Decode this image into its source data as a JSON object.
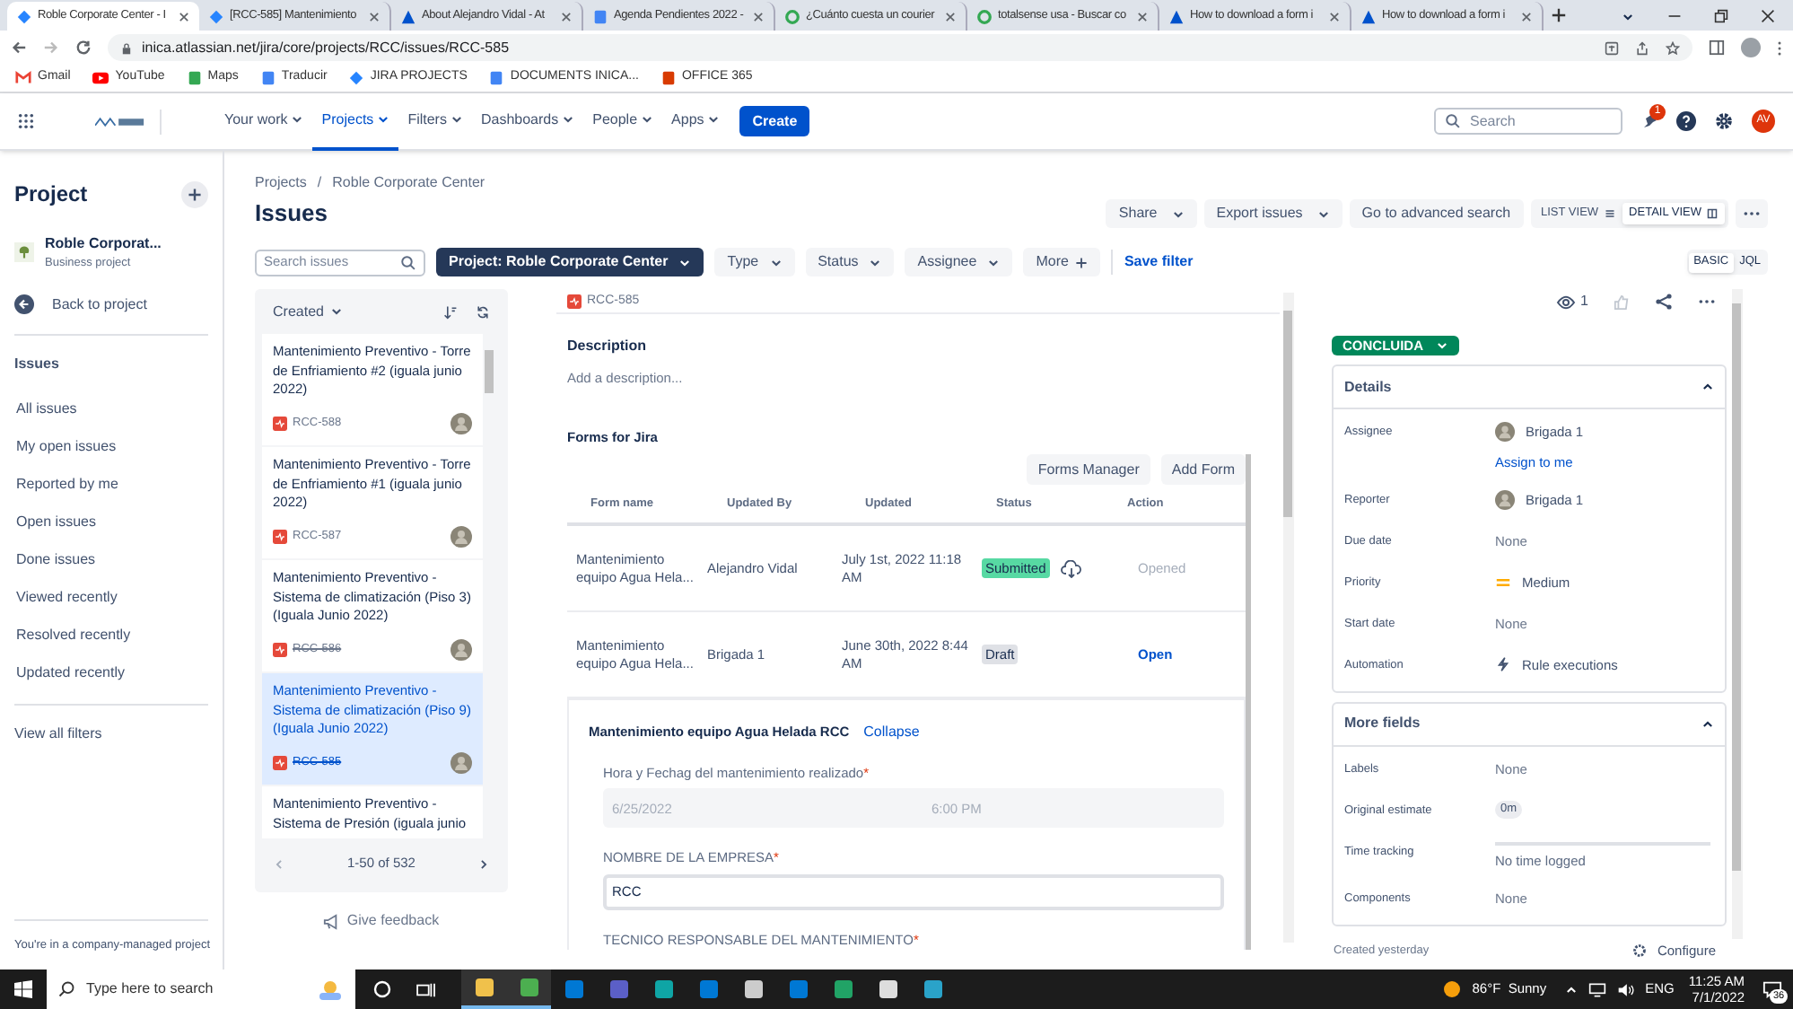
{
  "browser": {
    "tabs": [
      {
        "title": "Roble Corporate Center - I",
        "selected": true
      },
      {
        "title": "[RCC-585] Mantenimiento",
        "selected": false
      },
      {
        "title": "About Alejandro Vidal - At",
        "selected": false
      },
      {
        "title": "Agenda Pendientes 2022 -",
        "selected": false
      },
      {
        "title": "¿Cuánto cuesta un courier",
        "selected": false
      },
      {
        "title": "totalsense usa - Buscar co",
        "selected": false
      },
      {
        "title": "How to download a form i",
        "selected": false
      },
      {
        "title": "How to download a form i",
        "selected": false
      }
    ],
    "url": "inica.atlassian.net/jira/core/projects/RCC/issues/RCC-585",
    "bookmarks": [
      "Gmail",
      "YouTube",
      "Maps",
      "Traducir",
      "JIRA PROJECTS",
      "DOCUMENTS INICA...",
      "OFFICE 365"
    ]
  },
  "nav": {
    "items": [
      {
        "label": "Your work",
        "selected": false
      },
      {
        "label": "Projects",
        "selected": true
      },
      {
        "label": "Filters",
        "selected": false
      },
      {
        "label": "Dashboards",
        "selected": false
      },
      {
        "label": "People",
        "selected": false
      },
      {
        "label": "Apps",
        "selected": false
      }
    ],
    "create": "Create",
    "search_placeholder": "Search",
    "notification_count": "1",
    "avatar": "AV"
  },
  "sidebar": {
    "title": "Project",
    "project_name": "Roble Corporat...",
    "project_type": "Business project",
    "back": "Back to project",
    "section": "Issues",
    "items": [
      "All issues",
      "My open issues",
      "Reported by me",
      "Open issues",
      "Done issues",
      "Viewed recently",
      "Resolved recently",
      "Updated recently"
    ],
    "view_all": "View all filters",
    "footer": "You're in a company-managed project"
  },
  "breadcrumbs": [
    "Projects",
    "Roble Corporate Center"
  ],
  "breadcrumb_separator": "/",
  "page_title": "Issues",
  "header_actions": [
    {
      "label": "Share"
    },
    {
      "label": "Export issues"
    }
  ],
  "advanced_search": "Go to advanced search",
  "views": [
    {
      "label": "LIST VIEW",
      "selected": false
    },
    {
      "label": "DETAIL VIEW",
      "selected": true
    }
  ],
  "filters": {
    "search_placeholder": "Search issues",
    "chips": [
      {
        "label": "Project: Roble Corporate Center",
        "selected": true
      },
      {
        "label": "Type",
        "selected": false
      },
      {
        "label": "Status",
        "selected": false
      },
      {
        "label": "Assignee",
        "selected": false
      }
    ],
    "more": "More",
    "save": "Save filter",
    "modes": [
      {
        "label": "BASIC",
        "selected": true
      },
      {
        "label": "JQL",
        "selected": false
      }
    ]
  },
  "issue_list": {
    "sort": "Created",
    "items": [
      {
        "title": "Mantenimiento Preventivo - Torre de Enfriamiento #2 (iguala junio 2022)",
        "key": "RCC-588",
        "done": false,
        "selected": false
      },
      {
        "title": "Mantenimiento Preventivo - Torre de Enfriamiento #1 (iguala junio 2022)",
        "key": "RCC-587",
        "done": false,
        "selected": false
      },
      {
        "title": "Mantenimiento Preventivo - Sistema de climatización (Piso 3) (Iguala Junio 2022)",
        "key": "RCC-586",
        "done": true,
        "selected": false
      },
      {
        "title": "Mantenimiento Preventivo - Sistema de climatización (Piso 9) (Iguala Junio 2022)",
        "key": "RCC-585",
        "done": true,
        "selected": true
      },
      {
        "title": "Mantenimiento Preventivo - Sistema de Presión (iguala junio",
        "selected": false
      }
    ],
    "pagination": "1-50 of 532"
  },
  "feedback": "Give feedback",
  "issue": {
    "key": "RCC-585",
    "description_label": "Description",
    "description_placeholder": "Add a description...",
    "forms_title": "Forms for Jira",
    "form_buttons": [
      "Forms Manager",
      "Add Form"
    ],
    "columns": [
      "Form name",
      "Updated By",
      "Updated",
      "Status",
      "Action"
    ],
    "rows": [
      {
        "name": "Mantenimiento equipo Agua Hela...",
        "updated_by": "Alejandro Vidal",
        "updated": "July 1st, 2022 11:18 AM",
        "status": "Submitted",
        "color": "#57d9a3",
        "downloadable": true,
        "action": "Opened",
        "action_enabled": false
      },
      {
        "name": "Mantenimiento equipo Agua Hela...",
        "updated_by": "Brigada 1",
        "updated": "June 30th, 2022 8:44 AM",
        "status": "Draft",
        "color": "#dfe1e6",
        "downloadable": false,
        "action": "Open",
        "action_enabled": true
      }
    ],
    "open_form": {
      "title": "Mantenimiento equipo Agua Helada RCC",
      "collapse": "Collapse",
      "fields": [
        {
          "label": "Hora y Fechag del mantenimiento realizado",
          "required_mark": "*",
          "kind": "datetime",
          "date": "6/25/2022",
          "time": "6:00 PM"
        },
        {
          "label": "NOMBRE DE LA EMPRESA",
          "required_mark": "*",
          "kind": "text",
          "value": "RCC"
        },
        {
          "label": "TECNICO RESPONSABLE DEL MANTENIMIENTO",
          "required_mark": "*",
          "kind": "label"
        }
      ]
    }
  },
  "watchers": "1",
  "status_button": "CONCLUIDA",
  "details": {
    "title": "Details",
    "expanded": true,
    "fields": [
      {
        "label": "Assignee",
        "kind": "user",
        "value": "Brigada 1",
        "link": "Assign to me"
      },
      {
        "label": "Reporter",
        "kind": "user",
        "value": "Brigada 1"
      },
      {
        "label": "Due date",
        "kind": "none",
        "value": "None"
      },
      {
        "label": "Priority",
        "kind": "priority",
        "value": "Medium"
      },
      {
        "label": "Start date",
        "kind": "none",
        "value": "None"
      },
      {
        "label": "Automation",
        "kind": "automation",
        "value": "Rule executions"
      }
    ]
  },
  "more_fields": {
    "title": "More fields",
    "expanded": true,
    "fields": [
      {
        "label": "Labels",
        "kind": "none",
        "value": "None"
      },
      {
        "label": "Original estimate",
        "kind": "badge",
        "value": "0m"
      },
      {
        "label": "Time tracking",
        "kind": "tracking",
        "value": "No time logged"
      },
      {
        "label": "Components",
        "kind": "none",
        "value": "None"
      }
    ]
  },
  "created": "Created yesterday",
  "configure": "Configure",
  "taskbar": {
    "search_placeholder": "Type here to search",
    "weather": "86°F  Sunny",
    "lang": "ENG",
    "time": "11:25 AM",
    "date": "7/1/2022",
    "notifications": "36"
  }
}
